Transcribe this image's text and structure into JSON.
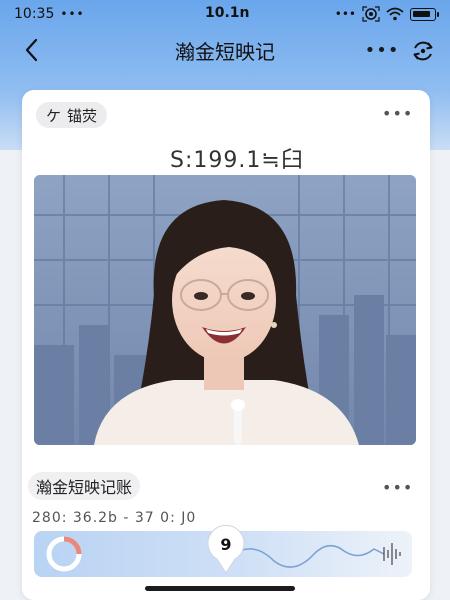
{
  "status_bar": {
    "time": "10:35",
    "signal_dots": "•••",
    "center_text": "10.1n"
  },
  "nav": {
    "title": "瀚金短映记",
    "more": "•••"
  },
  "card": {
    "tag_label": "锚荧",
    "tag_prefix": "ケ",
    "more": "•••",
    "price": "S:199.1≒⾅",
    "section_label": "瀚金短映记账",
    "section_more": "•••",
    "meta": "280: 36.2b - 37 0: J0",
    "player_number": "9"
  },
  "colors": {
    "band": "#6aa6ec",
    "card_bg": "#ffffff",
    "player_fill": "#b9d3f3"
  }
}
